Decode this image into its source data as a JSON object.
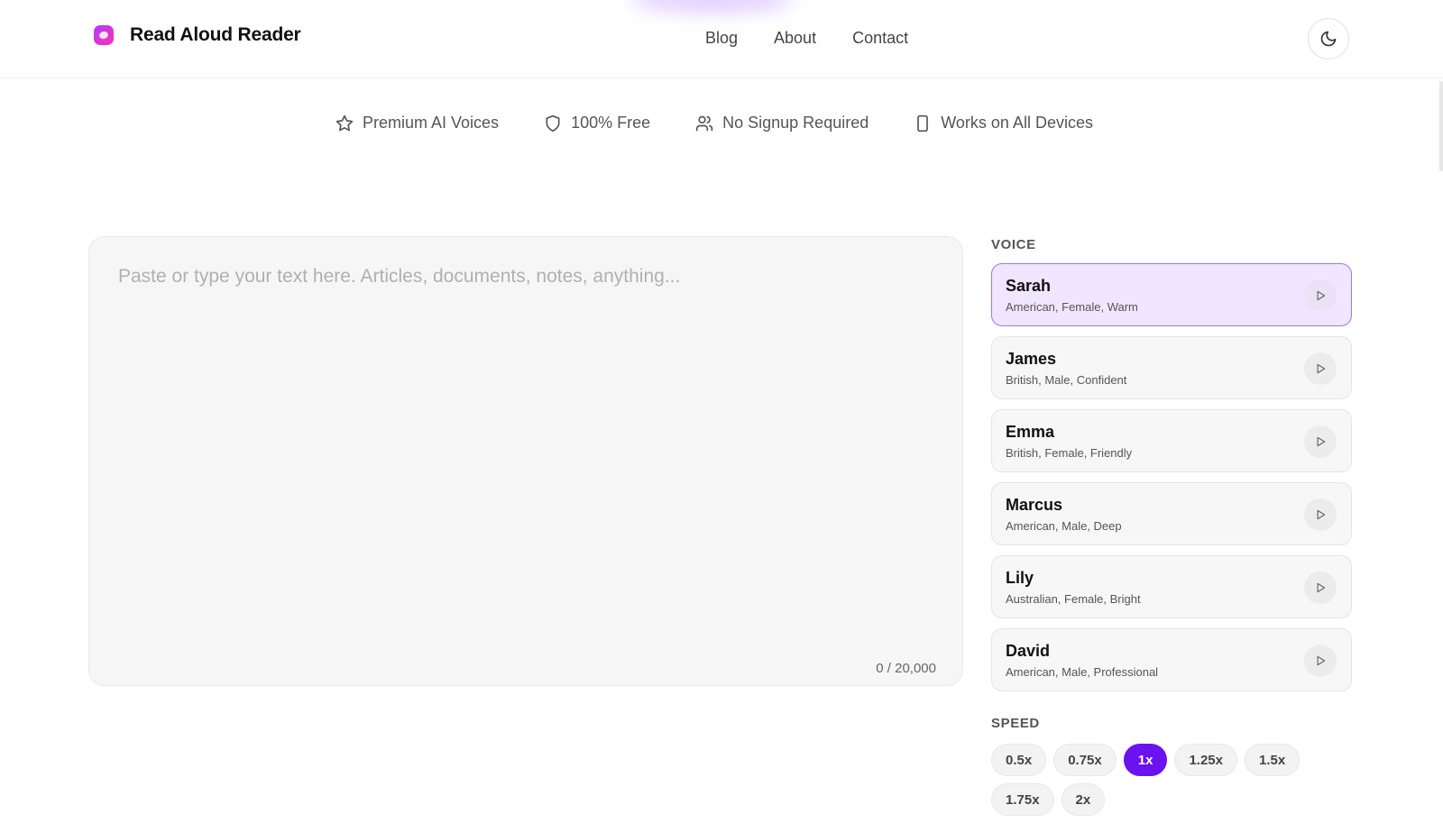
{
  "brand": {
    "name": "Read Aloud Reader",
    "accent": "#6b12f0"
  },
  "nav": {
    "items": [
      "Blog",
      "About",
      "Contact"
    ]
  },
  "theme_toggle": {
    "icon": "moon-icon"
  },
  "features": [
    {
      "icon": "star-icon",
      "label": "Premium AI Voices"
    },
    {
      "icon": "shield-icon",
      "label": "100% Free"
    },
    {
      "icon": "users-icon",
      "label": "No Signup Required"
    },
    {
      "icon": "smartphone-icon",
      "label": "Works on All Devices"
    }
  ],
  "editor": {
    "placeholder": "Paste or type your text here. Articles, documents, notes, anything...",
    "value": "",
    "counter": "0 / 20,000"
  },
  "voice": {
    "label": "VOICE",
    "items": [
      {
        "name": "Sarah",
        "desc": "American, Female, Warm",
        "selected": true
      },
      {
        "name": "James",
        "desc": "British, Male, Confident",
        "selected": false
      },
      {
        "name": "Emma",
        "desc": "British, Female, Friendly",
        "selected": false
      },
      {
        "name": "Marcus",
        "desc": "American, Male, Deep",
        "selected": false
      },
      {
        "name": "Lily",
        "desc": "Australian, Female, Bright",
        "selected": false
      },
      {
        "name": "David",
        "desc": "American, Male, Professional",
        "selected": false
      }
    ]
  },
  "speed": {
    "label": "SPEED",
    "options": [
      "0.5x",
      "0.75x",
      "1x",
      "1.25x",
      "1.5x",
      "1.75x",
      "2x"
    ],
    "selected": "1x"
  }
}
